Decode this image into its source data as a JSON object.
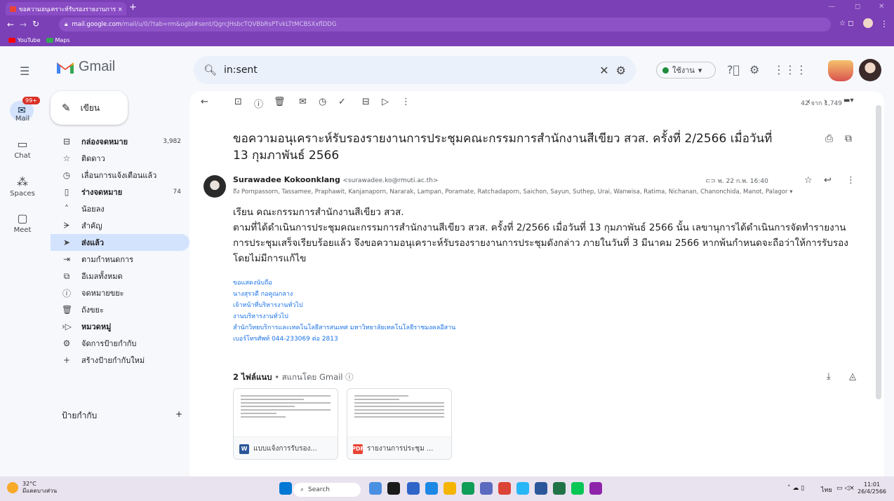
{
  "browser": {
    "tab_title": "ขอความอนุเคราะห์รับรองรายงานการ ×",
    "new_tab": "+",
    "url_host": "mail.google.com",
    "url_path": "/mail/u/0/?tab=rm&ogbl#sent/QgrcJHsbcTQVBbRsPTvkLTtMCBSXxflDDG",
    "bookmarks": [
      {
        "label": "YouTube",
        "color": "#ff0000"
      },
      {
        "label": "Maps",
        "color": "#34a853"
      }
    ]
  },
  "gmail": {
    "logo_text": "Gmail",
    "search_value": "in:sent",
    "status_label": "ใช้งาน",
    "rail": [
      {
        "label": "Mail",
        "icon": "mail-icon",
        "badge": "99+"
      },
      {
        "label": "Chat",
        "icon": "chat-icon"
      },
      {
        "label": "Spaces",
        "icon": "spaces-icon"
      },
      {
        "label": "Meet",
        "icon": "meet-icon"
      }
    ],
    "compose_label": "เขียน",
    "nav": [
      {
        "label": "กล่องจดหมาย",
        "count": "3,982",
        "icon": "inbox-icon",
        "bold": true
      },
      {
        "label": "ติดดาว",
        "icon": "star-icon"
      },
      {
        "label": "เลื่อนการแจ้งเตือนแล้ว",
        "icon": "clock-icon"
      },
      {
        "label": "ร่างจดหมาย",
        "count": "74",
        "icon": "draft-icon",
        "bold": true
      },
      {
        "label": "น้อยลง",
        "icon": "chevron-up-icon"
      },
      {
        "label": "สำคัญ",
        "icon": "important-icon"
      },
      {
        "label": "ส่งแล้ว",
        "icon": "send-icon",
        "active": true
      },
      {
        "label": "ตามกำหนดการ",
        "icon": "scheduled-icon"
      },
      {
        "label": "อีเมลทั้งหมด",
        "icon": "all-mail-icon"
      },
      {
        "label": "จดหมายขยะ",
        "icon": "spam-icon"
      },
      {
        "label": "ถังขยะ",
        "icon": "trash-icon"
      },
      {
        "label": "หมวดหมู่",
        "icon": "category-icon",
        "bold": true
      },
      {
        "label": "จัดการป้ายกำกับ",
        "icon": "gear-icon"
      },
      {
        "label": "สร้างป้ายกำกับใหม่",
        "icon": "plus-icon"
      }
    ],
    "labels_heading": "ป้ายกำกับ",
    "labels_add": "+"
  },
  "email": {
    "pager": "42 จาก 1,749",
    "subject": "ขอความอนุเคราะห์รับรองรายงานการประชุมคณะกรรมการสำนักงานสีเขียว สวส. ครั้งที่ 2/2566 เมื่อวันที่ 13 กุมภาพันธ์ 2566",
    "sender_name": "Surawadee Kokoonklang",
    "sender_email": "<surawadee.ko@rmuti.ac.th>",
    "to_line": "ถึง Pornpassorn, Tassamee, Praphawit, Kanjanaporn, Nararak, Lampan, Poramate, Ratchadaporn, Saichon, Sayun, Suthep, Urai, Wanwisa, Ratima, Nichanan, Chanonchida, Manot, Palagor ▾",
    "date": "พ. 22 ก.พ. 16:40",
    "greeting": "เรียน คณะกรรมการสำนักงานสีเขียว สวส.",
    "body": "ตามที่ได้ดำเนินการประชุมคณะกรรมการสำนักงานสีเขียว สวส. ครั้งที่ 2/2566 เมื่อวันที่ 13 กุมภาพันธ์ 2566 นั้น เลขานุการได้ดำเนินการจัดทำรายงานการประชุมเสร็จเรียบร้อยแล้ว จึงขอความอนุเคราะห์รับรองรายงานการประชุมดังกล่าว ภายในวันที่ 3 มีนาคม 2566 หากพ้นกำหนดจะถือว่าให้การรับรองโดยไม่มีการแก้ไข",
    "signature": [
      "ขอแสดงนับถือ",
      "นางสุรวดี  กอคูณกลาง",
      "เจ้าหน้าที่บริหารงานทั่วไป",
      "งานบริหารงานทั่วไป",
      "สำนักวิทยบริการและเทคโนโลยีสารสนเทศ มหาวิทยาลัยเทคโนโลยีราชมงคลอีสาน",
      "เบอร์โทรศัพท์ 044-233069 ต่อ 2813"
    ],
    "attach_count": "2 ไฟล์แนบ",
    "attach_scan": "• สแกนโดย Gmail ⓘ",
    "attachments": [
      {
        "name": "แบบแจ้งการรับรอง...",
        "type": "W",
        "color": "#2b579a"
      },
      {
        "name": "รายงานการประชุม ...",
        "type": "PDF",
        "color": "#ea4335"
      }
    ]
  },
  "taskbar": {
    "weather_temp": "32°C",
    "weather_desc": "มีแดดบางส่วน",
    "search_label": "Search",
    "lang": "ไทย",
    "time": "11:01",
    "date": "26/4/2566"
  }
}
